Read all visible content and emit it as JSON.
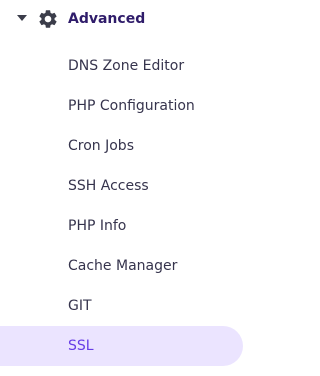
{
  "section": {
    "title": "Advanced",
    "expanded": true,
    "icon": "gear-icon",
    "caret_icon": "caret-down-icon"
  },
  "menu": {
    "items": [
      {
        "label": "DNS Zone Editor",
        "active": false
      },
      {
        "label": "PHP Configuration",
        "active": false
      },
      {
        "label": "Cron Jobs",
        "active": false
      },
      {
        "label": "SSH Access",
        "active": false
      },
      {
        "label": "PHP Info",
        "active": false
      },
      {
        "label": "Cache Manager",
        "active": false
      },
      {
        "label": "GIT",
        "active": false
      },
      {
        "label": "SSL",
        "active": true
      }
    ]
  },
  "colors": {
    "text": "#36344d",
    "section_title": "#2f1c6a",
    "icon": "#3b3d4a",
    "active_text": "#673de6",
    "active_background": "#ebe4ff"
  }
}
